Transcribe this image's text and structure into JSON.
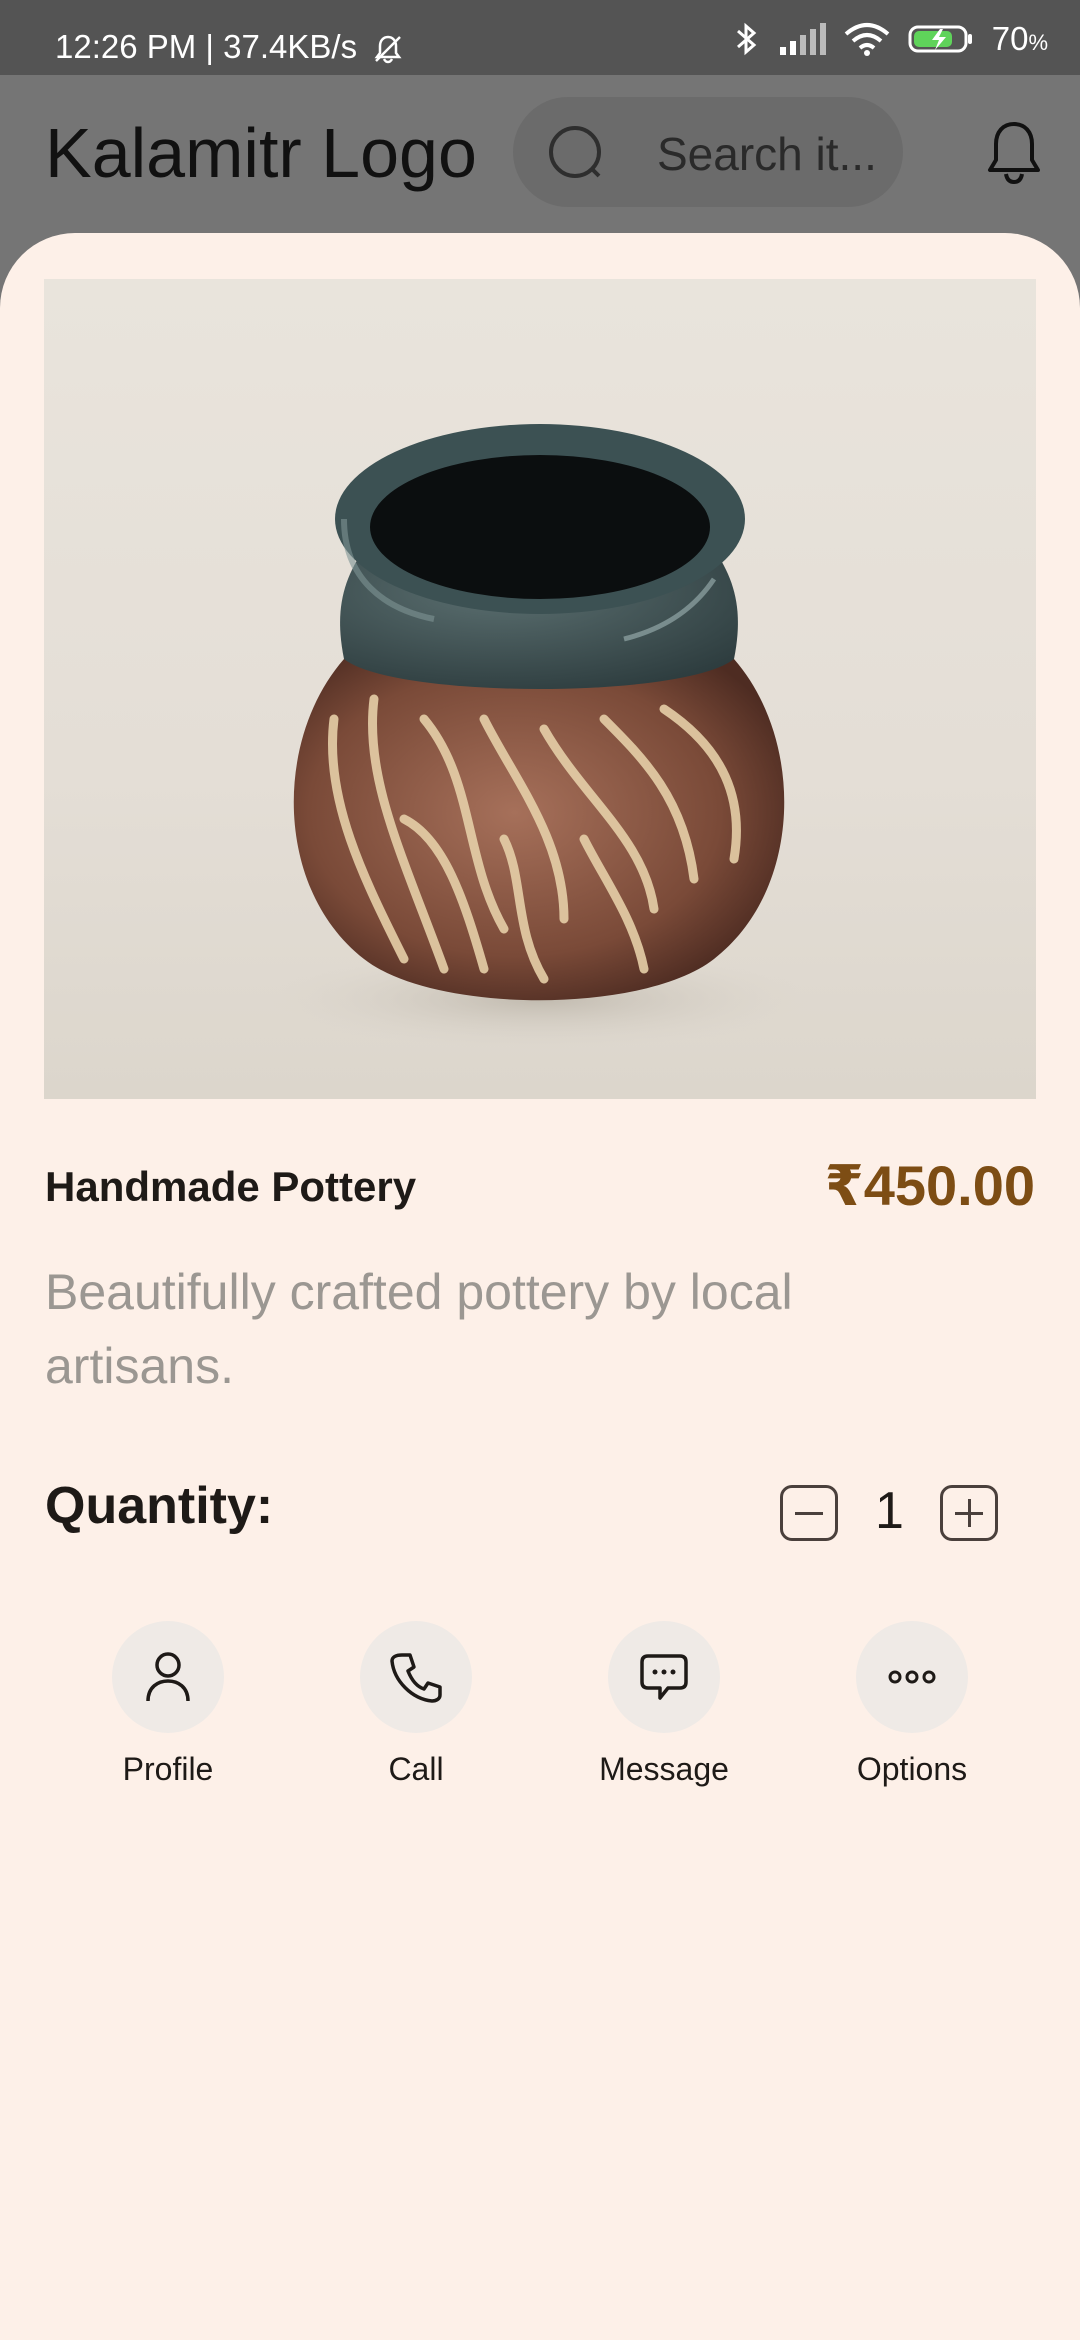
{
  "status_bar": {
    "time_speed": "12:26 PM | 37.4KB/s",
    "battery_percent": "70",
    "battery_unit": "%"
  },
  "header": {
    "logo_text": "Kalamitr Logo",
    "search_placeholder": "Search it..."
  },
  "product": {
    "name": "Handmade Pottery",
    "price": "₹450.00",
    "description": "Beautifully crafted pottery by local artisans.",
    "quantity_label": "Quantity:",
    "quantity_value": "1"
  },
  "actions": [
    {
      "label": "Profile",
      "icon": "person-icon"
    },
    {
      "label": "Call",
      "icon": "phone-icon"
    },
    {
      "label": "Message",
      "icon": "chat-bubble-icon"
    },
    {
      "label": "Options",
      "icon": "more-horizontal-icon"
    }
  ],
  "colors": {
    "header_bg": "#757575",
    "card_bg": "#fdf0e8",
    "price": "#7d4d14",
    "description": "#9b9792"
  }
}
